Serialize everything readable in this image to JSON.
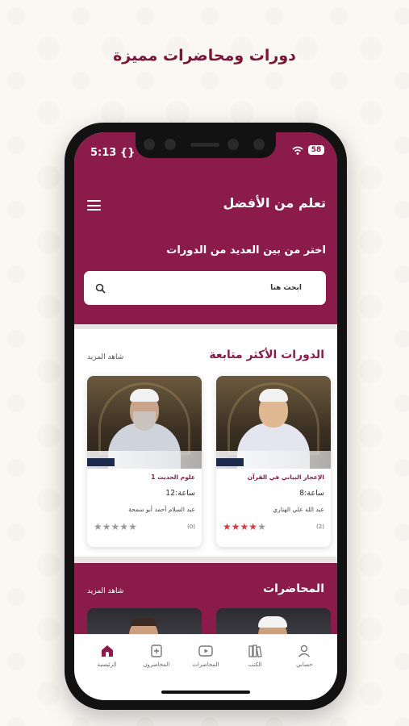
{
  "promo": {
    "title": "دورات ومحاضرات مميزة"
  },
  "status": {
    "time": "5:13",
    "dev_icon": "{}",
    "battery": "58"
  },
  "header": {
    "title": "تعلم من الأفضل",
    "subtitle": "اختر من بين العديد من الدورات"
  },
  "search": {
    "placeholder": "ابحث هنا"
  },
  "popular": {
    "title": "الدورات الأكثر متابعة",
    "see_more": "شاهد المزيد",
    "cards": [
      {
        "course": "الإعجاز البياني في القرآن",
        "hours": "ساعة:8",
        "teacher": "عبد الله علي الهتاري",
        "rating": 4,
        "count": "(2)"
      },
      {
        "course": "علوم الحديث 1",
        "hours": "ساعة:12",
        "teacher": "عبد السلام أحمد أبو سمحة",
        "rating": 0,
        "count": "(0)"
      }
    ]
  },
  "lectures": {
    "title": "المحاضرات",
    "see_more": "شاهد المزيد"
  },
  "tabbar": [
    {
      "label": "حسابي",
      "icon": "user-icon"
    },
    {
      "label": "الكتب",
      "icon": "books-icon"
    },
    {
      "label": "المحاضرات",
      "icon": "video-icon"
    },
    {
      "label": "المحاضرون",
      "icon": "lecturer-icon"
    },
    {
      "label": "الرئيسية",
      "icon": "home-icon"
    }
  ],
  "colors": {
    "brand": "#8a1b4a",
    "star": "#d43c3c"
  }
}
